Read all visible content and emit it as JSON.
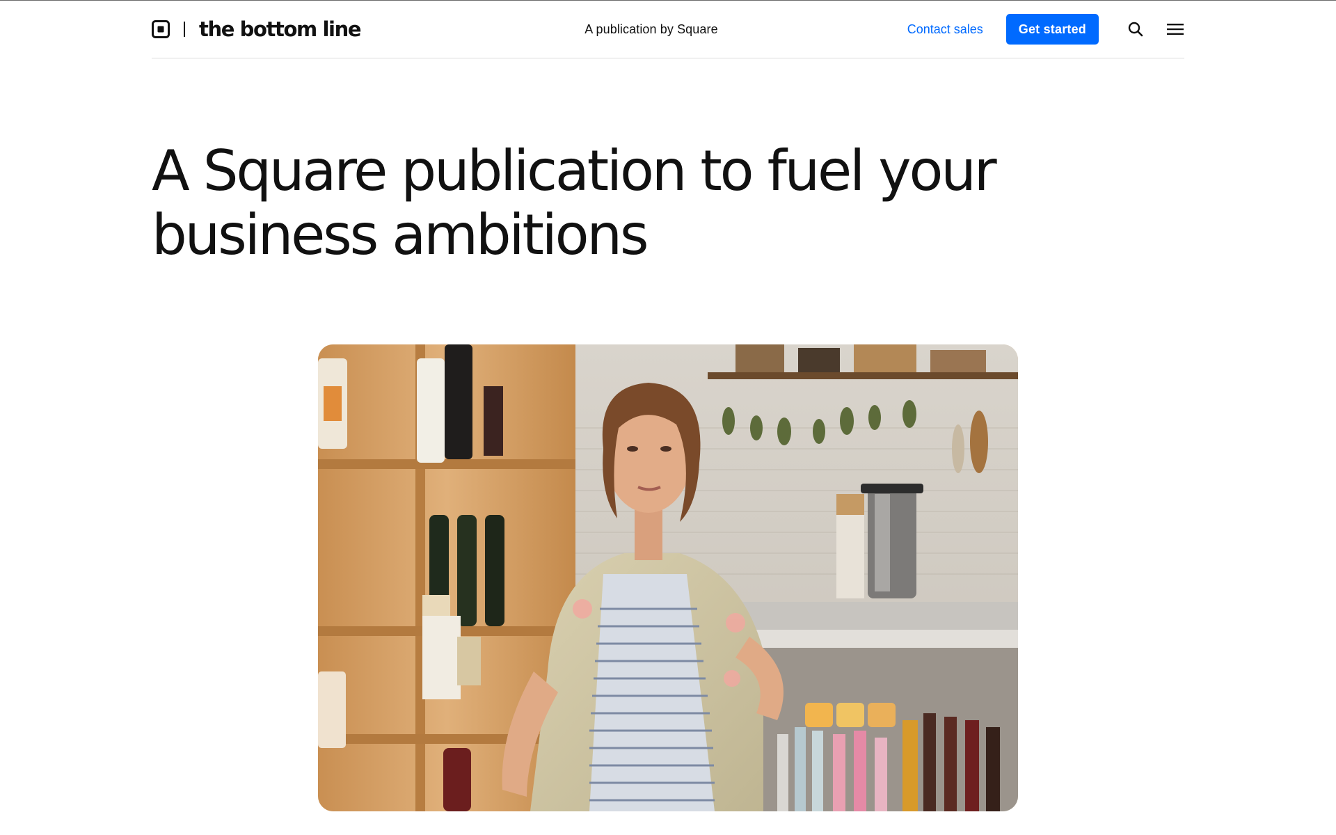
{
  "header": {
    "logo_icon": "square-logo-icon",
    "brand_name": "the bottom line",
    "tagline": "A publication by Square",
    "contact_label": "Contact sales",
    "cta_label": "Get started",
    "search_icon": "search-icon",
    "menu_icon": "hamburger-menu-icon"
  },
  "hero": {
    "title": "A Square publication to fuel your business ambitions",
    "image": {
      "subject": "photo",
      "alt": ""
    }
  },
  "colors": {
    "accent": "#006aff",
    "text": "#111111",
    "divider": "#dcdcdc",
    "background": "#ffffff"
  }
}
